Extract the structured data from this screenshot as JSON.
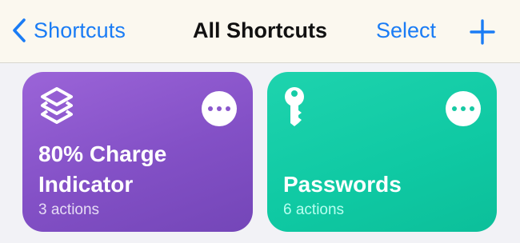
{
  "navbar": {
    "back_label": "Shortcuts",
    "title": "All Shortcuts",
    "select_label": "Select"
  },
  "colors": {
    "accent": "#1a7cf5",
    "navbar_bg": "#fbf8ef",
    "card_purple": "#8a57cc",
    "card_green": "#16c9a3"
  },
  "shortcuts": [
    {
      "title": "80% Charge Indicator",
      "actions": "3 actions",
      "icon": "layers-icon",
      "color": "purple"
    },
    {
      "title": "Passwords",
      "actions": "6 actions",
      "icon": "key-icon",
      "color": "green"
    }
  ]
}
